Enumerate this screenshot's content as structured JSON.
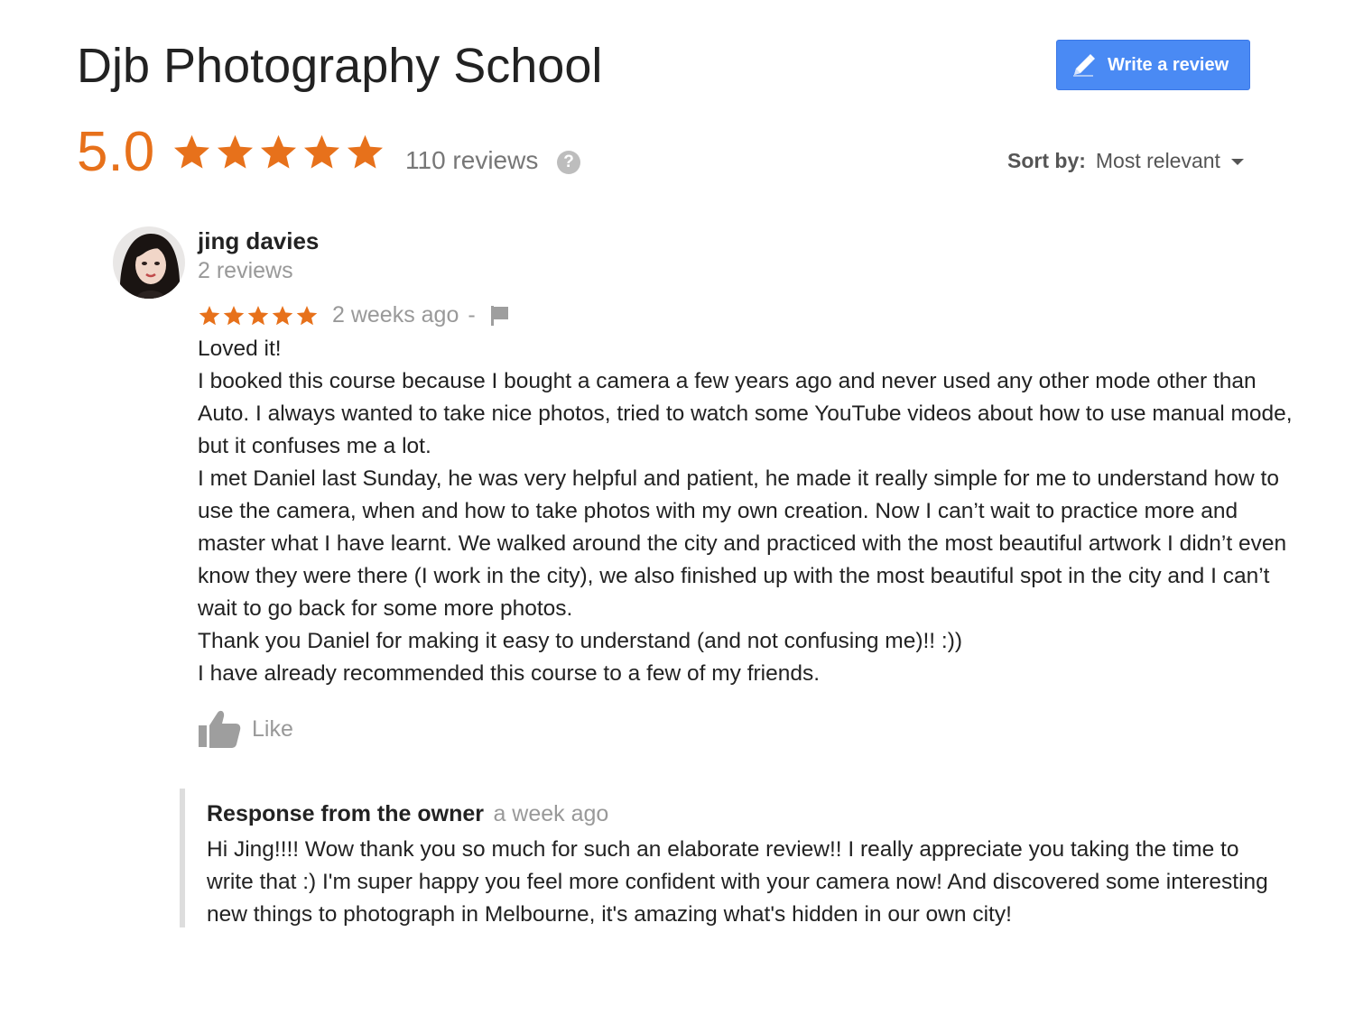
{
  "business": {
    "name": "Djb Photography School"
  },
  "write_review_button": {
    "label": "Write a review"
  },
  "summary": {
    "rating": "5.0",
    "stars": 5,
    "review_count": "110 reviews",
    "help_glyph": "?"
  },
  "sort": {
    "label": "Sort by:",
    "value": "Most relevant"
  },
  "review": {
    "author": "jing davies",
    "author_review_count": "2 reviews",
    "stars": 5,
    "time": "2 weeks ago",
    "separator": "-",
    "body_lines": [
      "Loved it!",
      "I booked this course because I bought a camera a few years ago and never used any other mode other than Auto. I always wanted to take nice photos, tried to watch some YouTube videos about how to use manual mode, but it confuses me a lot.",
      "I met Daniel last Sunday, he was very helpful and patient, he made it really simple for me to understand how to use the camera, when and how to take photos with my own creation. Now I can’t wait to practice more and master what I have learnt. We walked around the city and practiced with the most beautiful artwork I didn’t even know they were there (I work in the city), we also finished up with the most beautiful spot in the city and I can’t wait to go back for some more photos.",
      "Thank you Daniel for making it easy to understand (and not confusing me)!! :))",
      "I have already recommended this course to a few of my friends."
    ],
    "like_label": "Like"
  },
  "owner_response": {
    "title": "Response from the owner",
    "time": "a week ago",
    "text": "Hi Jing!!!! Wow thank you so much for such an elaborate review!! I really appreciate you taking the time to write that :) I'm super happy you feel more confident with your camera now! And discovered some interesting new things to photograph in Melbourne, it's amazing what's hidden in our own city!"
  },
  "colors": {
    "star": "#e7711b",
    "rating": "#e7711b",
    "button": "#4a8af4",
    "muted": "#999999"
  },
  "icons": {
    "write": "pencil-icon",
    "help": "help-icon",
    "sort_caret": "caret-down-icon",
    "flag": "flag-icon",
    "like": "thumbs-up-icon",
    "star": "star-icon",
    "avatar": "avatar"
  }
}
